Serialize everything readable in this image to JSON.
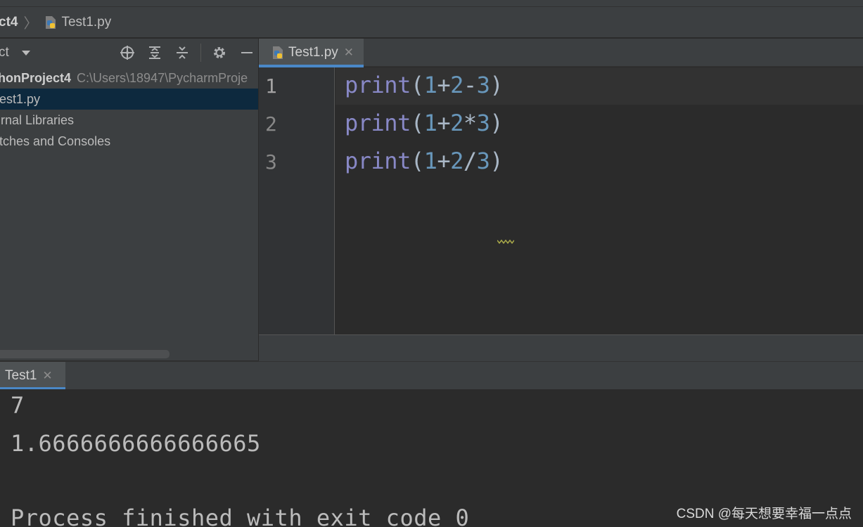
{
  "breadcrumb": {
    "project": "ct4",
    "file": "Test1.py"
  },
  "project_panel": {
    "title": "ct",
    "tree": {
      "root_name": "honProject4",
      "root_path": "C:\\Users\\18947\\PycharmProje",
      "file": "est1.py",
      "external_libraries": "rnal Libraries",
      "scratches": "tches and Consoles"
    }
  },
  "editor": {
    "tab_label": "Test1.py",
    "lines": [
      {
        "num": "1",
        "fn": "print",
        "open": "(",
        "a": "1",
        "op1": "+",
        "b": "2",
        "op2": "-",
        "c": "3",
        "close": ")"
      },
      {
        "num": "2",
        "fn": "print",
        "open": "(",
        "a": "1",
        "op1": "+",
        "b": "2",
        "op2": "*",
        "c": "3",
        "close": ")"
      },
      {
        "num": "3",
        "fn": "print",
        "open": "(",
        "a": "1",
        "op1": "+",
        "b": "2",
        "op2": "/",
        "c": "3",
        "close": ")"
      }
    ]
  },
  "run_panel": {
    "tab_label": "Test1",
    "output": [
      "7",
      "1.6666666666666665",
      "",
      "Process finished with exit code 0"
    ]
  },
  "watermark": "CSDN @每天想要幸福一点点",
  "colors": {
    "accent": "#4a88c7",
    "keyword": "#8888c6",
    "number": "#6897bb",
    "selection": "#0d293e"
  }
}
